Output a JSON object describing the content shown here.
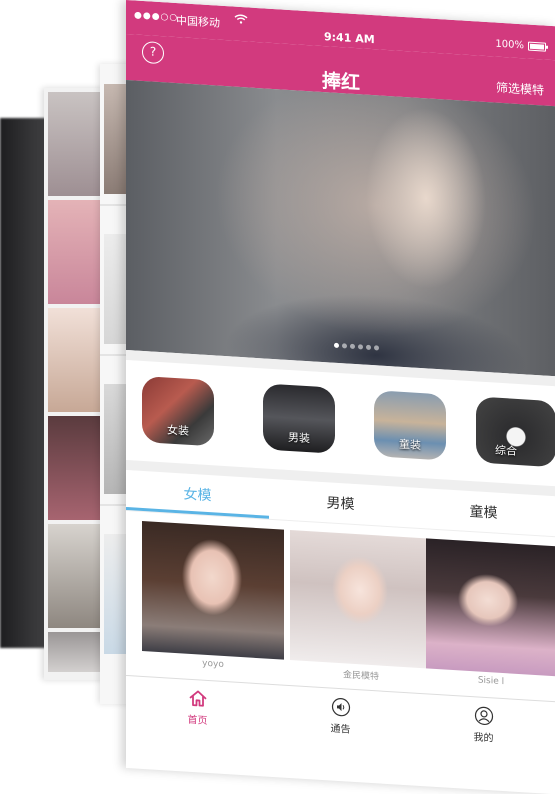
{
  "status_bar": {
    "signal": "●●●○○",
    "carrier": "中国移动",
    "time": "9:41 AM",
    "battery": "100%",
    "battery_level": 1.0
  },
  "nav": {
    "help": "?",
    "title": "捧红",
    "filter": "筛选模特"
  },
  "banner": {
    "dot_count": 6,
    "active_dot": 0
  },
  "categories": [
    {
      "label": "女装",
      "icon": "womenswear-photo"
    },
    {
      "label": "男装",
      "icon": "menswear-photo"
    },
    {
      "label": "童装",
      "icon": "kidswear-photo"
    },
    {
      "label": "综合",
      "icon": "misc-photo"
    }
  ],
  "tabs": [
    {
      "label": "女模",
      "active": true
    },
    {
      "label": "男模",
      "active": false
    },
    {
      "label": "童模",
      "active": false
    }
  ],
  "models": [
    {
      "name": "yoyo"
    },
    {
      "name": "金民模特"
    },
    {
      "name": "Sisie l"
    }
  ],
  "tabbar": [
    {
      "label": "首页",
      "icon": "home-icon",
      "active": true
    },
    {
      "label": "通告",
      "icon": "speaker-icon",
      "active": false
    },
    {
      "label": "我的",
      "icon": "profile-icon",
      "active": false
    }
  ],
  "colors": {
    "brand": "#d23a7e",
    "tab_active": "#5ab4e5"
  }
}
